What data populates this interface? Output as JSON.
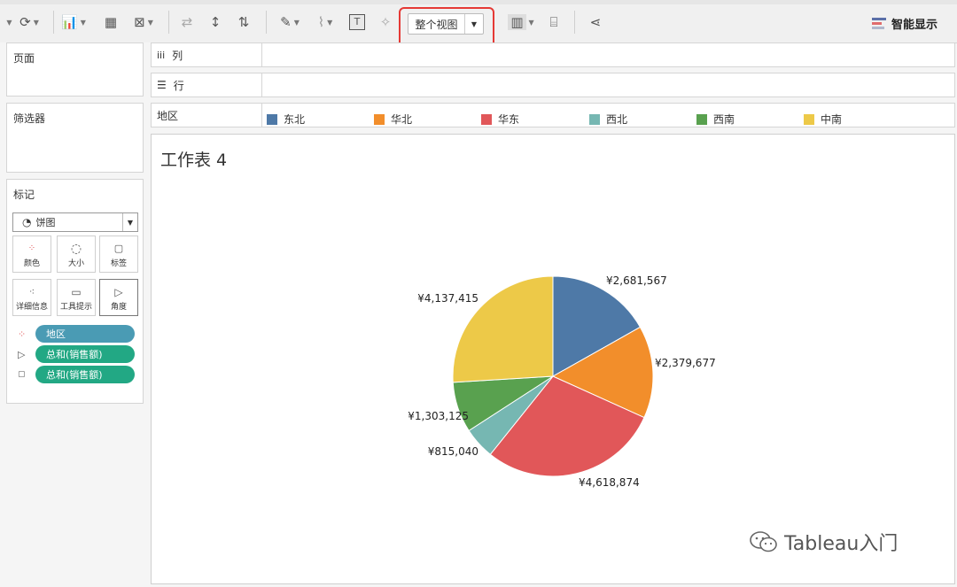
{
  "toolbar": {
    "view_dropdown": "整个视图",
    "smart_show": "智能显示",
    "label_icon": "T"
  },
  "panes": {
    "pages": "页面",
    "filters": "筛选器",
    "marks": "标记"
  },
  "marks": {
    "type": "饼图",
    "buttons": [
      "颜色",
      "大小",
      "标签",
      "详细信息",
      "工具提示",
      "角度"
    ],
    "pills": [
      {
        "label": "地区",
        "icon": "color-dots-icon",
        "color": "#4a9bb4"
      },
      {
        "label": "总和(销售额)",
        "icon": "angle-icon",
        "color": "#22a884"
      },
      {
        "label": "总和(销售额)",
        "icon": "label-icon",
        "color": "#22a884"
      }
    ]
  },
  "shelves": {
    "columns": "列",
    "rows": "行",
    "legend_title": "地区"
  },
  "sheet": {
    "title": "工作表 4"
  },
  "chart_data": {
    "type": "pie",
    "categories": [
      "东北",
      "华北",
      "华东",
      "西北",
      "西南",
      "中南"
    ],
    "values": [
      2681567,
      2379677,
      4618874,
      815040,
      1303125,
      4137415
    ],
    "labels": [
      "¥2,681,567",
      "¥2,379,677",
      "¥4,618,874",
      "¥815,040",
      "¥1,303,125",
      "¥4,137,415"
    ],
    "colors": [
      "#4e79a7",
      "#f28e2b",
      "#e15759",
      "#76b7b2",
      "#59a14f",
      "#edc948"
    ],
    "legend": "top"
  },
  "watermark": "Tableau入门"
}
